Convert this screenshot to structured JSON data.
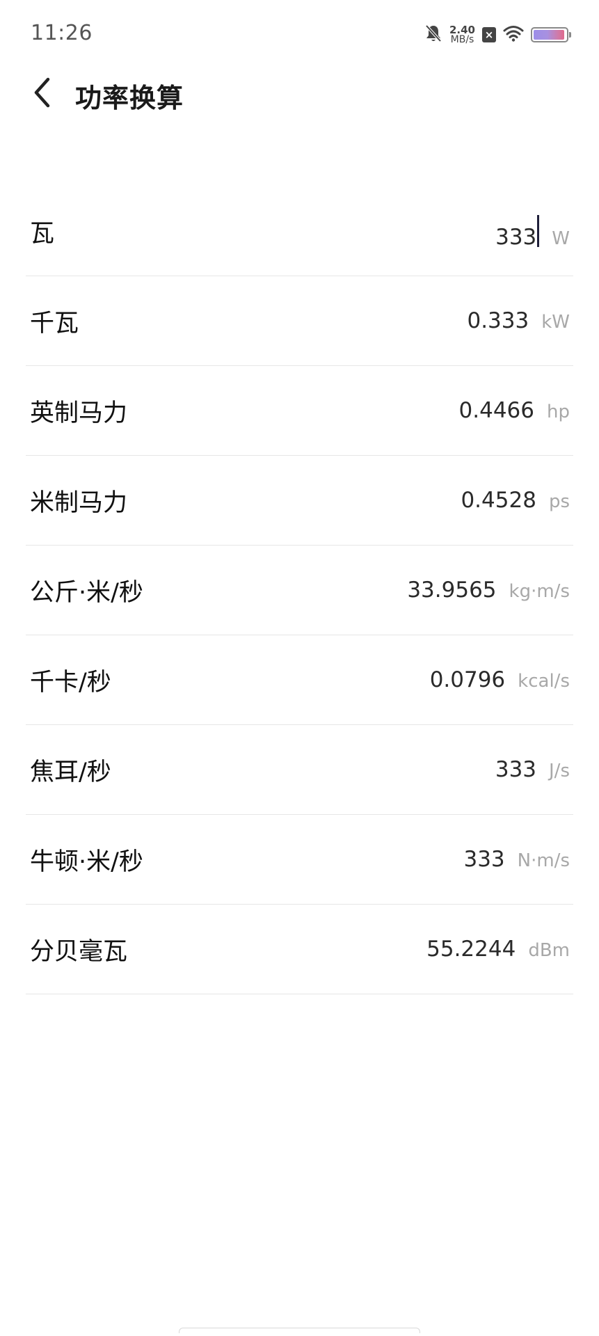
{
  "status_bar": {
    "time": "11:26",
    "network_speed_value": "2.40",
    "network_speed_unit": "MB/s",
    "sim_badge": "×",
    "icons": [
      "mute-bell-icon",
      "sim-x-icon",
      "wifi-icon",
      "battery-icon"
    ],
    "battery_fill_fraction": 0.95
  },
  "header": {
    "back_icon": "chevron-left-icon",
    "title": "功率换算"
  },
  "rows": [
    {
      "label": "瓦",
      "value": "333",
      "unit": "W",
      "active": true
    },
    {
      "label": "千瓦",
      "value": "0.333",
      "unit": "kW"
    },
    {
      "label": "英制马力",
      "value": "0.4466",
      "unit": "hp"
    },
    {
      "label": "米制马力",
      "value": "0.4528",
      "unit": "ps"
    },
    {
      "label": "公斤·米/秒",
      "value": "33.9565",
      "unit": "kg·m/s"
    },
    {
      "label": "千卡/秒",
      "value": "0.0796",
      "unit": "kcal/s"
    },
    {
      "label": "焦耳/秒",
      "value": "333",
      "unit": "J/s"
    },
    {
      "label": "牛顿·米/秒",
      "value": "333",
      "unit": "N·m/s"
    },
    {
      "label": "分贝毫瓦",
      "value": "55.2244",
      "unit": "dBm"
    }
  ],
  "colors": {
    "caret": "#1f1f3a",
    "unit_text": "#a8a8a8",
    "divider": "#e6e6e6",
    "battery_gradient_start": "#9c8ee8",
    "battery_gradient_end": "#e06a8c"
  }
}
